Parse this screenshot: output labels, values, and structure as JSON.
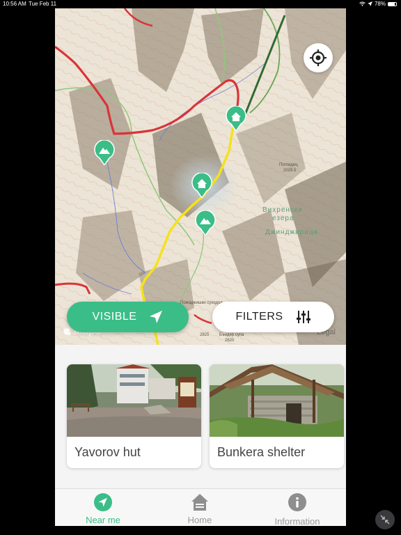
{
  "status_bar": {
    "time": "10:56 AM",
    "date": "Tue Feb 11",
    "battery": "78%",
    "battery_level": 0.78
  },
  "map": {
    "peak_label_1": "Погледец",
    "peak_label_1_elev": "2029.5",
    "lakes_label_1": "Вихренски",
    "lakes_label_2": "езера",
    "lakes_label_3": "Джинджирица",
    "peak_label_2": "Пожаджишки суходол",
    "peak_label_2_elev": "2825",
    "peak_label_3": "Бъндер супа",
    "peak_label_3_elev": "2620",
    "maps_logo": "Maps",
    "legal": "Legal"
  },
  "buttons": {
    "visible_label": "VISIBLE",
    "filters_label": "FILTERS"
  },
  "icons": {
    "locate": "locate-crosshair-icon",
    "navigate": "navigation-arrow-icon",
    "filters": "sliders-icon",
    "hut": "house-icon",
    "peak": "mountain-icon"
  },
  "colors": {
    "accent": "#3bbd88",
    "trail_yellow": "#f5e21b",
    "trail_red": "#d9343a"
  },
  "places": [
    {
      "name": "Yavorov hut"
    },
    {
      "name": "Bunkera shelter"
    }
  ],
  "tabs": [
    {
      "label": "Near me",
      "active": true
    },
    {
      "label": "Home",
      "active": false
    },
    {
      "label": "Information",
      "active": false
    }
  ]
}
